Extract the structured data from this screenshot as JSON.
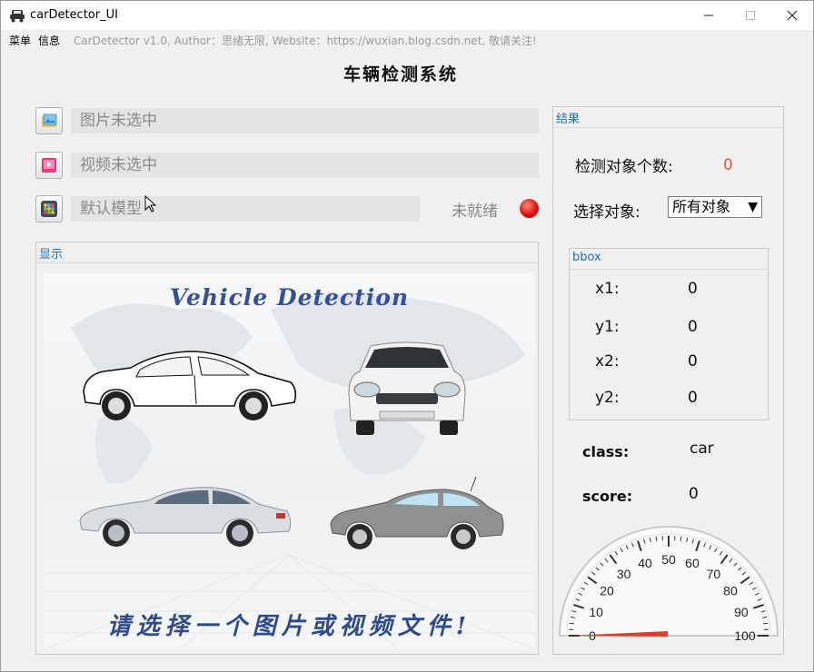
{
  "window": {
    "title": "carDetector_UI"
  },
  "menubar": {
    "items": [
      "菜单",
      "信息"
    ],
    "info": "CarDetector v1.0, Author：思绪无限, Website：https://wuxian.blog.csdn.net, 敬请关注!"
  },
  "main": {
    "title": "车辆检测系统",
    "image_field": "图片未选中",
    "video_field": "视频未选中",
    "model_field": "默认模型",
    "model_status": "未就绪",
    "status_color": "#e01010"
  },
  "display": {
    "group_title": "显示",
    "banner_title": "Vehicle Detection",
    "prompt": "请选择一个图片或视频文件!"
  },
  "results": {
    "group_title": "结果",
    "count_label": "检测对象个数:",
    "count_value": "0",
    "count_color": "#e8553a",
    "select_label": "选择对象:",
    "select_value": "所有对象",
    "bbox": {
      "group_title": "bbox",
      "x1_label": "x1:",
      "x1": "0",
      "y1_label": "y1:",
      "y1": "0",
      "x2_label": "x2:",
      "x2": "0",
      "y2_label": "y2:",
      "y2": "0"
    },
    "class_label": "class:",
    "class_value": "car",
    "score_label": "score:",
    "score_value": "0"
  },
  "gauge": {
    "value": 0,
    "min": 0,
    "max": 100,
    "ticks": [
      "0",
      "10",
      "20",
      "30",
      "40",
      "50",
      "60",
      "70",
      "80",
      "90",
      "100"
    ],
    "needle_color": "#d9412e"
  }
}
